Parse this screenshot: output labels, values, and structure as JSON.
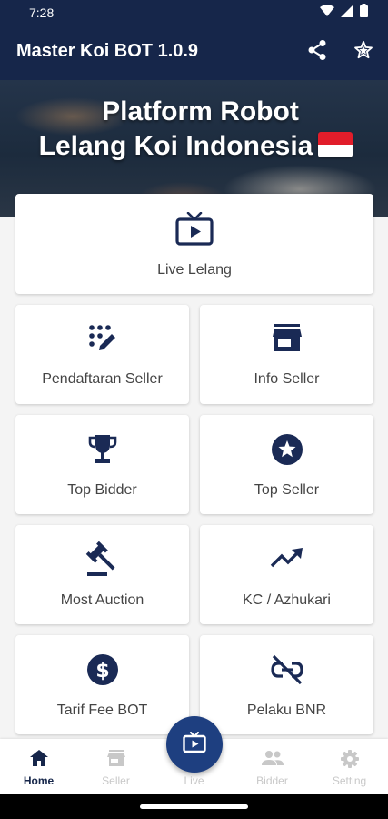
{
  "status_bar": {
    "time": "7:28"
  },
  "app_bar": {
    "title": "Master Koi BOT 1.0.9"
  },
  "hero": {
    "line1": "Platform Robot",
    "line2": "Lelang Koi Indonesia"
  },
  "menu": {
    "live_lelang": "Live Lelang",
    "pendaftaran_seller": "Pendaftaran Seller",
    "info_seller": "Info Seller",
    "top_bidder": "Top Bidder",
    "top_seller": "Top Seller",
    "most_auction": "Most Auction",
    "kc_azhukari": "KC / Azhukari",
    "tarif_fee_bot": "Tarif Fee BOT",
    "pelaku_bnr": "Pelaku BNR"
  },
  "bottom_nav": {
    "home": "Home",
    "seller": "Seller",
    "live": "Live",
    "bidder": "Bidder",
    "setting": "Setting"
  },
  "colors": {
    "primary": "#16264a",
    "fab": "#1e3f80",
    "icon": "#1a2a55",
    "inactive": "#c8c8c8"
  }
}
